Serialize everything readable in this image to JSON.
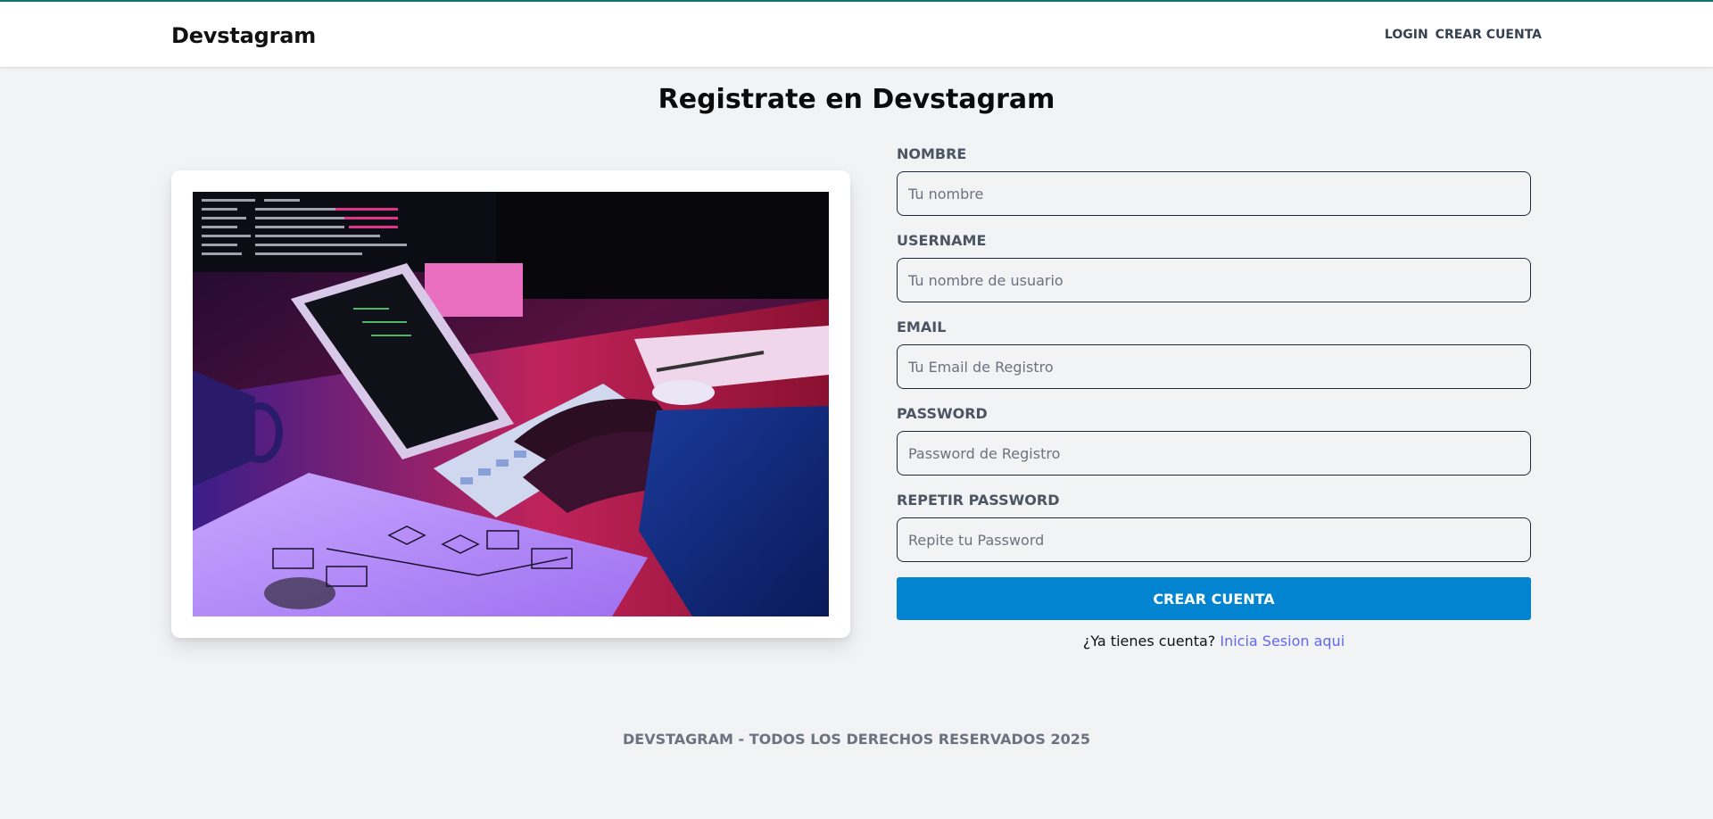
{
  "header": {
    "logo": "Devstagram",
    "nav": {
      "login": "LOGIN",
      "register": "CREAR CUENTA"
    }
  },
  "main": {
    "title": "Registrate en Devstagram",
    "image": {
      "alt": "Developer typing code at a neon-lit desk"
    },
    "form": {
      "fields": [
        {
          "label": "NOMBRE",
          "placeholder": "Tu nombre",
          "value": ""
        },
        {
          "label": "USERNAME",
          "placeholder": "Tu nombre de usuario",
          "value": ""
        },
        {
          "label": "EMAIL",
          "placeholder": "Tu Email de Registro",
          "value": ""
        },
        {
          "label": "PASSWORD",
          "placeholder": "Password de Registro",
          "value": ""
        },
        {
          "label": "REPETIR PASSWORD",
          "placeholder": "Repite tu Password",
          "value": ""
        }
      ],
      "submit_label": "CREAR CUENTA",
      "login_prompt": "¿Ya tienes cuenta?",
      "login_link": "Inicia Sesion aqui"
    }
  },
  "footer": {
    "text": "DEVSTAGRAM - TODOS LOS DERECHOS RESERVADOS 2025"
  },
  "colors": {
    "accent_button": "#0284d0",
    "link": "#6366f1",
    "page_bg": "#f2f3f5",
    "top_border": "#0f766e"
  }
}
